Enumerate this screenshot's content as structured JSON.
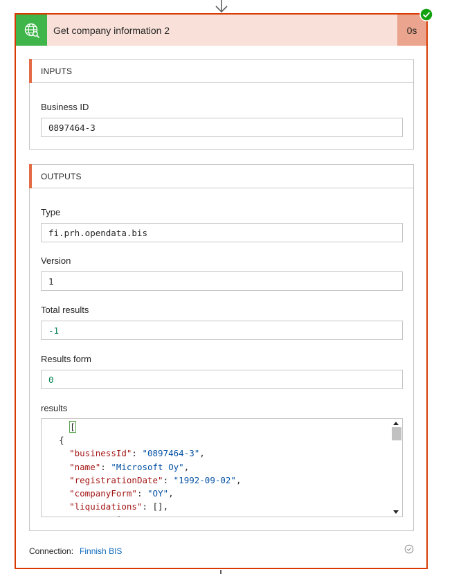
{
  "action": {
    "title": "Get company information 2",
    "duration": "0s",
    "status": "succeeded",
    "icon": "globe-search-icon"
  },
  "colors": {
    "border_accent": "#d83b01",
    "header_bg": "#f9e1da",
    "icon_bg": "#3fb54a",
    "duration_bg": "#eba48d",
    "section_accent": "#e36c46",
    "success": "#13a10e",
    "link": "#0f6cbd"
  },
  "inputs": {
    "section_title": "INPUTS",
    "fields": [
      {
        "label": "Business ID",
        "value": "0897464-3"
      }
    ]
  },
  "outputs": {
    "section_title": "OUTPUTS",
    "fields": [
      {
        "label": "Type",
        "value": "fi.prh.opendata.bis"
      },
      {
        "label": "Version",
        "value": "1"
      },
      {
        "label": "Total results",
        "value": "-1"
      },
      {
        "label": "Results form",
        "value": "0"
      }
    ],
    "results": {
      "label": "results",
      "json_lines": [
        {
          "text": "["
        },
        {
          "text": "{"
        },
        {
          "key": "\"businessId\"",
          "value": "\"0897464-3\"",
          "trail": ","
        },
        {
          "key": "\"name\"",
          "value": "\"Microsoft Oy\"",
          "trail": ","
        },
        {
          "key": "\"registrationDate\"",
          "value": "\"1992-09-02\"",
          "trail": ","
        },
        {
          "key": "\"companyForm\"",
          "value": "\"OY\"",
          "trail": ","
        },
        {
          "key": "\"liquidations\"",
          "value": "[]",
          "trail": ","
        },
        {
          "key": "\"names\"",
          "value": "[",
          "trail": ""
        }
      ]
    }
  },
  "connection": {
    "label": "Connection:",
    "name": "Finnish BIS"
  }
}
